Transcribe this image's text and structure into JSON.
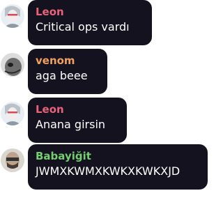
{
  "messages": [
    {
      "sender": "Leon",
      "text": "Critical ops vardı",
      "name_color": "#e8637a",
      "avatar_icon": "leon-avatar"
    },
    {
      "sender": "venom",
      "text": "aga beee",
      "name_color": "#f0a060",
      "avatar_icon": "venom-avatar"
    },
    {
      "sender": "Leon",
      "text": "Anana girsin",
      "name_color": "#e8637a",
      "avatar_icon": "leon-avatar"
    },
    {
      "sender": "Babayiğit",
      "text": "JWMXKWMXKWKXKWKXJD",
      "name_color": "#72d06e",
      "avatar_icon": "babayigit-avatar"
    }
  ],
  "colors": {
    "bubble_bg": "#15121f",
    "message_text": "#ffffff",
    "page_bg": "#ffffff"
  }
}
